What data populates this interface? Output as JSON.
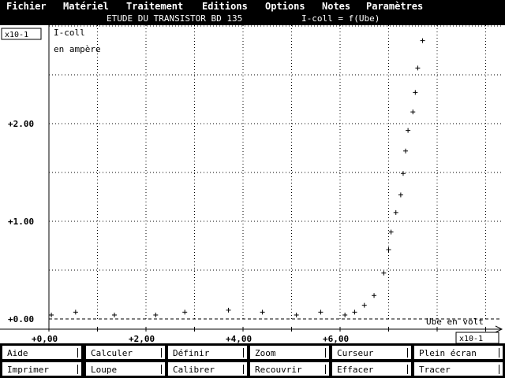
{
  "menu": [
    {
      "label": "Fichier",
      "key": "F"
    },
    {
      "label": "Matériel",
      "key": "M"
    },
    {
      "label": "Traitement",
      "key": "T"
    },
    {
      "label": "Editions",
      "key": "E"
    },
    {
      "label": "Options",
      "key": "O"
    },
    {
      "label": "Notes",
      "key": "N"
    },
    {
      "label": "Paramètres",
      "key": "P"
    }
  ],
  "title": {
    "left": "ETUDE DU TRANSISTOR BD 135",
    "right": "I-coll = f(Ube)"
  },
  "chart_data": {
    "type": "scatter",
    "title": "ETUDE DU TRANSISTOR BD 135    I-coll = f(Ube)",
    "ylabel": "I-coll",
    "ylabel_unit": "en ampère",
    "xlabel": "Ube en volt",
    "x_scale_label": "x10-1",
    "y_scale_label": "x10-1",
    "x_ticks": [
      "+0,00",
      "+2,00",
      "+4,00",
      "+6,00"
    ],
    "y_ticks": [
      "+0.00",
      "+1.00",
      "+2.00"
    ],
    "xlim": [
      0,
      9.2
    ],
    "ylim": [
      -0.02,
      3.0
    ],
    "grid": true,
    "marker": "+",
    "colors": {
      "background": "#ffffff",
      "grid": "#000000",
      "points": "#000000"
    },
    "x": [
      0.05,
      0.55,
      1.35,
      2.2,
      2.8,
      3.7,
      4.4,
      5.1,
      5.6,
      6.1,
      6.3,
      6.5,
      6.7,
      6.9,
      7.0,
      7.05,
      7.15,
      7.25,
      7.3,
      7.35,
      7.4,
      7.5,
      7.55,
      7.6,
      7.7
    ],
    "y": [
      0.04,
      0.07,
      0.04,
      0.04,
      0.07,
      0.09,
      0.07,
      0.04,
      0.07,
      0.04,
      0.07,
      0.14,
      0.24,
      0.47,
      0.71,
      0.89,
      1.09,
      1.27,
      1.49,
      1.72,
      1.93,
      2.12,
      2.32,
      2.57,
      2.85
    ]
  },
  "buttons": [
    [
      {
        "label": "Aide",
        "key": "1"
      },
      {
        "label": "Calculer",
        "key": "2"
      },
      {
        "label": "Définir",
        "key": "3"
      },
      {
        "label": "Zoom",
        "key": "4"
      },
      {
        "label": "Curseur",
        "key": "5"
      },
      {
        "label": "Plein écran",
        "key": "6"
      }
    ],
    [
      {
        "label": "Imprimer",
        "key": "7"
      },
      {
        "label": "Loupe",
        "key": "8"
      },
      {
        "label": "Calibrer",
        "key": "9"
      },
      {
        "label": "Recouvrir",
        "key": "0"
      },
      {
        "label": "Effacer",
        "key": "A"
      },
      {
        "label": "Tracer",
        "key": "B"
      }
    ]
  ]
}
